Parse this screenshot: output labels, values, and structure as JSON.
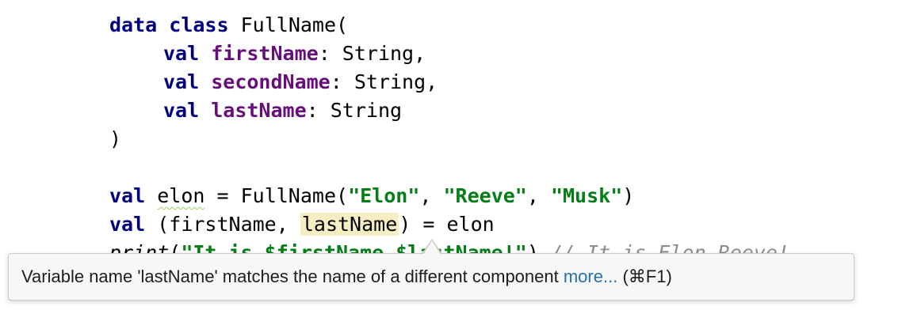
{
  "code": {
    "line1": {
      "kw1": "data",
      "kw2": "class",
      "name": "FullName("
    },
    "line2": {
      "kw": "val",
      "prop": "firstName",
      "type": ": String,"
    },
    "line3": {
      "kw": "val",
      "prop": "secondName",
      "type": ": String,"
    },
    "line4": {
      "kw": "val",
      "prop": "lastName",
      "type": ": String"
    },
    "line5": {
      "text": ")"
    },
    "line6": {
      "kw": "val",
      "var": "elon",
      "mid": " = FullName(",
      "s1": "\"Elon\"",
      "c1": ", ",
      "s2": "\"Reeve\"",
      "c2": ", ",
      "s3": "\"Musk\"",
      "end": ")"
    },
    "line7": {
      "kw": "val",
      "open": "(firstName, ",
      "var": "lastName",
      "end": ") = elon"
    },
    "line8": {
      "fn": "print",
      "open": "(",
      "str": "\"It is $firstName $lastName!\"",
      "close": ")",
      "comment": "// It is Elon Reeve!"
    }
  },
  "tooltip": {
    "message": "Variable name 'lastName' matches the name of a different component ",
    "link": "more...",
    "shortcut": " (⌘F1)"
  }
}
